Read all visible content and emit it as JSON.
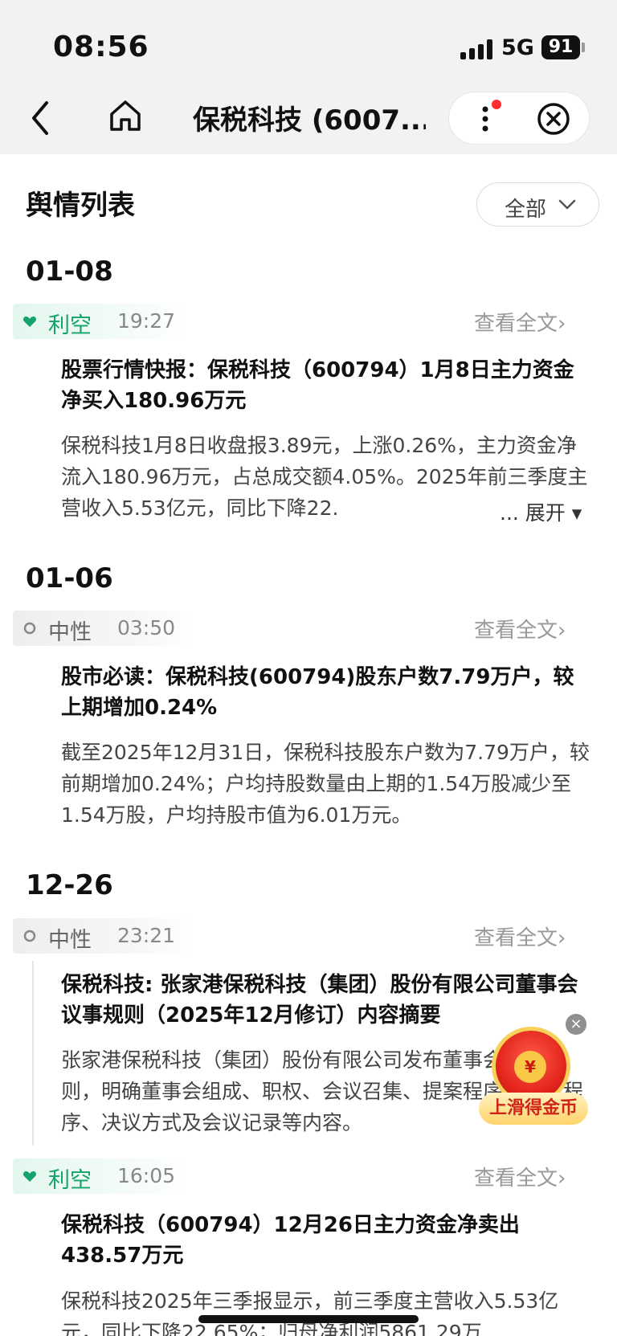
{
  "status_bar": {
    "time": "08:56",
    "network": "5G",
    "battery": "91"
  },
  "nav": {
    "title": "保税科技 (6007..."
  },
  "list": {
    "title": "舆情列表",
    "filter_label": "全部"
  },
  "groups": [
    {
      "date": "01-08",
      "items": [
        {
          "sentiment": "利空",
          "time": "19:27",
          "view_label": "查看全文›",
          "title": "股票行情快报：保税科技（600794）1月8日主力资金净买入180.96万元",
          "body": "保税科技1月8日收盘报3.89元，上涨0.26%，主力资金净流入180.96万元，占总成交额4.05%。2025年前三季度主营收入5.53亿元，同比下降22.",
          "expand_label": "... 展开 ▾"
        }
      ]
    },
    {
      "date": "01-06",
      "items": [
        {
          "sentiment": "中性",
          "time": "03:50",
          "view_label": "查看全文›",
          "title": "股市必读：保税科技(600794)股东户数7.79万户，较上期增加0.24%",
          "body": "截至2025年12月31日，保税科技股东户数为7.79万户，较前期增加0.24%；户均持股数量由上期的1.54万股减少至1.54万股，户均持股市值为6.01万元。"
        }
      ]
    },
    {
      "date": "12-26",
      "items": [
        {
          "sentiment": "中性",
          "time": "23:21",
          "view_label": "查看全文›",
          "title": "保税科技: 张家港保税科技（集团）股份有限公司董事会议事规则（2025年12月修订）内容摘要",
          "body": "张家港保税科技（集团）股份有限公司发布董事会议事规则，明确董事会组成、职权、会议召集、提案程序、议事程序、决议方式及会议记录等内容。"
        },
        {
          "sentiment": "利空",
          "time": "16:05",
          "view_label": "查看全文›",
          "title": "保税科技（600794）12月26日主力资金净卖出438.57万元",
          "body": "保税科技2025年三季报显示，前三季度主营收入5.53亿元，同比下降22.65%；归母净利润5861.29万"
        }
      ]
    }
  ],
  "promo": {
    "label": "上滑得金币",
    "coin_glyph": "¥",
    "close_glyph": "×"
  },
  "colors": {
    "bearish": "#14a36b",
    "neutral": "#888888",
    "accent_red": "#ff2d2d"
  },
  "icons": [
    "back-arrow-icon",
    "home-icon",
    "more-vertical-icon",
    "close-circle-icon",
    "chevron-down-icon",
    "heart-icon",
    "circle-icon"
  ]
}
